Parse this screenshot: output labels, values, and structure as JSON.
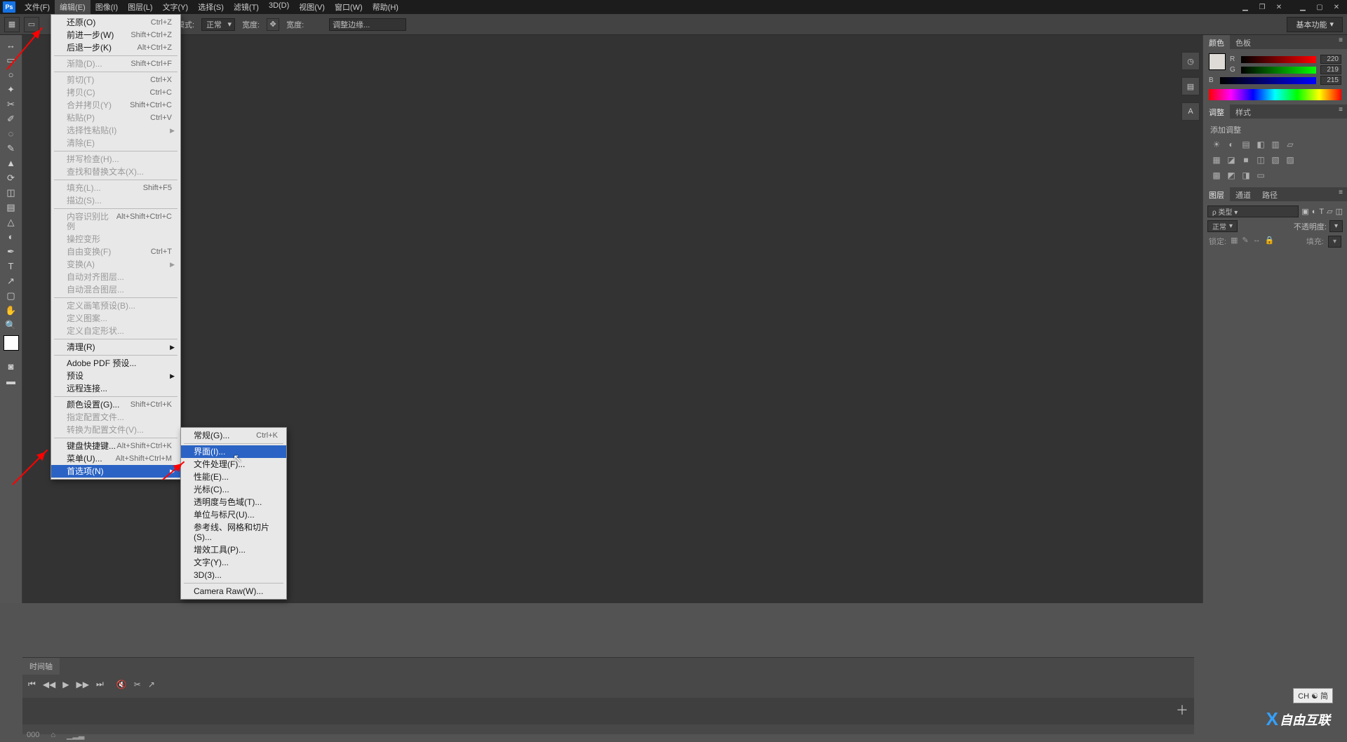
{
  "menubar": {
    "items": [
      "文件(F)",
      "编辑(E)",
      "图像(I)",
      "图层(L)",
      "文字(Y)",
      "选择(S)",
      "滤镜(T)",
      "3D(D)",
      "视图(V)",
      "窗口(W)",
      "帮助(H)"
    ],
    "active_index": 1
  },
  "window_controls": {
    "min": "▁",
    "max": "▢",
    "close": "✕",
    "restore": "❐"
  },
  "optionsbar": {
    "mode_label": "模式:",
    "mode_value": "正常",
    "tol_label": "宽度:",
    "tol_value": "",
    "input2_label": "宽度:",
    "workspace": "基本功能",
    "filterbox": "调整边缘..."
  },
  "dropdown": {
    "rows": [
      {
        "l": "还原(O)",
        "s": "Ctrl+Z"
      },
      {
        "l": "前进一步(W)",
        "s": "Shift+Ctrl+Z"
      },
      {
        "l": "后退一步(K)",
        "s": "Alt+Ctrl+Z"
      },
      {
        "sep": true
      },
      {
        "l": "渐隐(D)...",
        "s": "Shift+Ctrl+F",
        "d": true
      },
      {
        "sep": true
      },
      {
        "l": "剪切(T)",
        "s": "Ctrl+X",
        "d": true
      },
      {
        "l": "拷贝(C)",
        "s": "Ctrl+C",
        "d": true
      },
      {
        "l": "合并拷贝(Y)",
        "s": "Shift+Ctrl+C",
        "d": true
      },
      {
        "l": "粘贴(P)",
        "s": "Ctrl+V",
        "d": true
      },
      {
        "l": "选择性粘贴(I)",
        "sub": true,
        "d": true
      },
      {
        "l": "清除(E)",
        "d": true
      },
      {
        "sep": true
      },
      {
        "l": "拼写检查(H)...",
        "d": true
      },
      {
        "l": "查找和替换文本(X)...",
        "d": true
      },
      {
        "sep": true
      },
      {
        "l": "填充(L)...",
        "s": "Shift+F5",
        "d": true
      },
      {
        "l": "描边(S)...",
        "d": true
      },
      {
        "sep": true
      },
      {
        "l": "内容识别比例",
        "s": "Alt+Shift+Ctrl+C",
        "d": true
      },
      {
        "l": "操控变形",
        "d": true
      },
      {
        "l": "自由变换(F)",
        "s": "Ctrl+T",
        "d": true
      },
      {
        "l": "变换(A)",
        "sub": true,
        "d": true
      },
      {
        "l": "自动对齐图层...",
        "d": true
      },
      {
        "l": "自动混合图层...",
        "d": true
      },
      {
        "sep": true
      },
      {
        "l": "定义画笔预设(B)...",
        "d": true
      },
      {
        "l": "定义图案...",
        "d": true
      },
      {
        "l": "定义自定形状...",
        "d": true
      },
      {
        "sep": true
      },
      {
        "l": "清理(R)",
        "sub": true
      },
      {
        "sep": true
      },
      {
        "l": "Adobe PDF 预设..."
      },
      {
        "l": "预设",
        "sub": true
      },
      {
        "l": "远程连接..."
      },
      {
        "sep": true
      },
      {
        "l": "颜色设置(G)...",
        "s": "Shift+Ctrl+K"
      },
      {
        "l": "指定配置文件...",
        "d": true
      },
      {
        "l": "转换为配置文件(V)...",
        "d": true
      },
      {
        "sep": true
      },
      {
        "l": "键盘快捷键...",
        "s": "Alt+Shift+Ctrl+K"
      },
      {
        "l": "菜单(U)...",
        "s": "Alt+Shift+Ctrl+M"
      },
      {
        "l": "首选项(N)",
        "sub": true,
        "hl": true
      }
    ]
  },
  "submenu": {
    "rows": [
      {
        "l": "常规(G)...",
        "s": "Ctrl+K"
      },
      {
        "sep": true
      },
      {
        "l": "界面(I)...",
        "hl": true
      },
      {
        "l": "文件处理(F)..."
      },
      {
        "l": "性能(E)..."
      },
      {
        "l": "光标(C)..."
      },
      {
        "l": "透明度与色域(T)..."
      },
      {
        "l": "单位与标尺(U)..."
      },
      {
        "l": "参考线、网格和切片(S)..."
      },
      {
        "l": "增效工具(P)..."
      },
      {
        "l": "文字(Y)..."
      },
      {
        "l": "3D(3)..."
      },
      {
        "sep": true
      },
      {
        "l": "Camera Raw(W)..."
      }
    ]
  },
  "panels": {
    "color_tabs": [
      "颜色",
      "色板"
    ],
    "rgb": [
      {
        "ch": "R",
        "v": "220",
        "grad": "linear-gradient(to right,#000,#f00)"
      },
      {
        "ch": "G",
        "v": "219",
        "grad": "linear-gradient(to right,#000,#0f0)"
      },
      {
        "ch": "B",
        "v": "215",
        "grad": "linear-gradient(to right,#000,#00f)"
      }
    ],
    "adjust_tabs": [
      "调整",
      "样式"
    ],
    "adjust_title": "添加调整",
    "layer_tabs": [
      "图层",
      "通道",
      "路径"
    ],
    "blend": "正常",
    "opacity_label": "不透明度:",
    "lock_label": "锁定:",
    "fill_label": "填充:"
  },
  "timeline": {
    "tab": "时间轴",
    "zoom": "▁▂▃"
  },
  "ime": "CH ☯ 简",
  "watermark": "自由互联",
  "tooltips": {
    "tools": [
      "移动",
      "矩形选框",
      "套索",
      "魔棒",
      "裁剪",
      "吸管",
      "修复",
      "画笔",
      "图章",
      "历史画笔",
      "橡皮",
      "渐变",
      "模糊",
      "减淡",
      "钢笔",
      "文字",
      "路径",
      "形状",
      "抓手",
      "缩放"
    ]
  }
}
